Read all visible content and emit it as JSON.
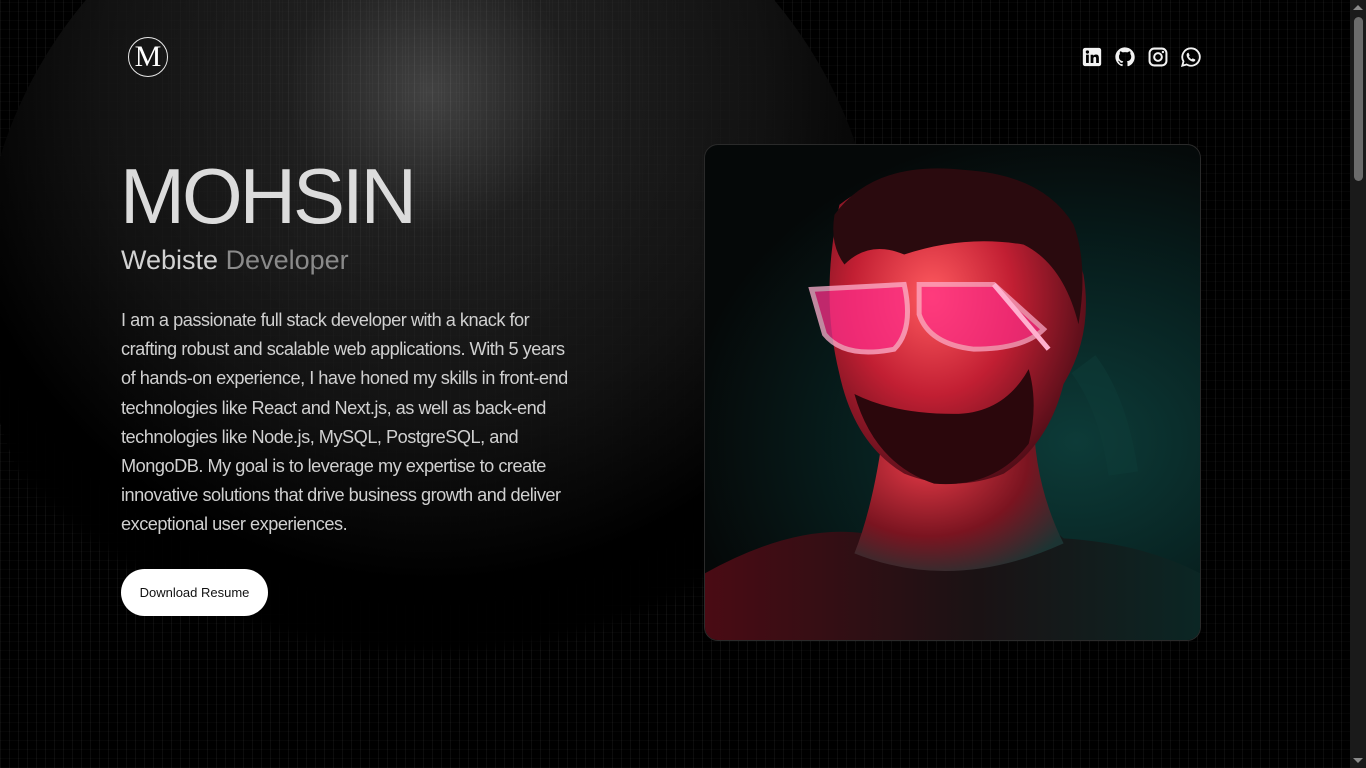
{
  "header": {
    "logo_letter": "M",
    "social_links": [
      {
        "name": "linkedin-icon"
      },
      {
        "name": "github-icon"
      },
      {
        "name": "instagram-icon"
      },
      {
        "name": "whatsapp-icon"
      }
    ]
  },
  "hero": {
    "name": "MOHSIN",
    "role_first": "Webiste",
    "role_second": "Developer",
    "about": "I am a passionate full stack developer with a knack for crafting robust and scalable web applications. With 5 years of hands-on experience, I have honed my skills in front-end technologies like React and Next.js, as well as back-end technologies like Node.js, MySQL, PostgreSQL, and MongoDB. My goal is to leverage my expertise to create innovative solutions that drive business growth and deliver exceptional user experiences.",
    "resume_button": "Download Resume"
  },
  "portrait": {
    "description_icon": "portrait-photo"
  },
  "colors": {
    "background": "#000000",
    "text": "#d0d0d0",
    "accent_red": "#e8253f",
    "accent_teal": "#0d3b38",
    "button_bg": "#ffffff"
  }
}
